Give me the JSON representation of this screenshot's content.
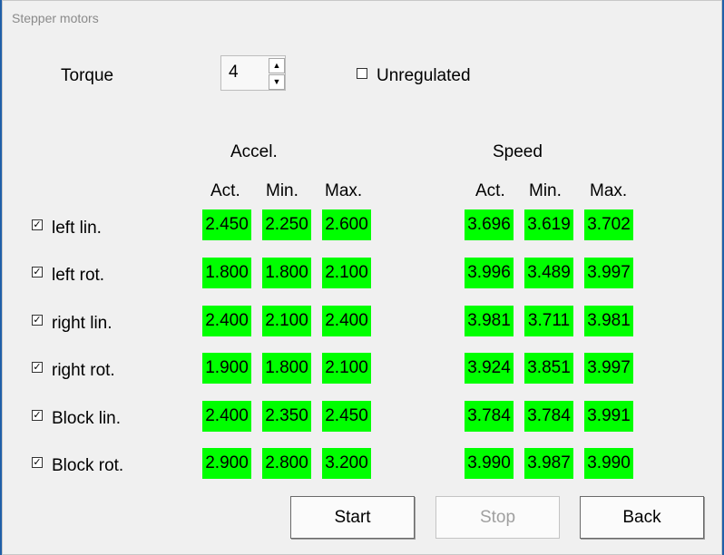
{
  "window": {
    "title": "Stepper motors"
  },
  "torque": {
    "label": "Torque",
    "value": "4",
    "up_arrow": "▲",
    "down_arrow": "▼"
  },
  "unregulated": {
    "label": "Unregulated",
    "checked": false
  },
  "groups": {
    "accel": "Accel.",
    "speed": "Speed"
  },
  "columns": {
    "act": "Act.",
    "min": "Min.",
    "max": "Max."
  },
  "check_mark": "✓",
  "rows": [
    {
      "label": "left lin.",
      "checked": true,
      "accel": [
        "2.450",
        "2.250",
        "2.600"
      ],
      "speed": [
        "3.696",
        "3.619",
        "3.702"
      ]
    },
    {
      "label": "left rot.",
      "checked": true,
      "accel": [
        "1.800",
        "1.800",
        "2.100"
      ],
      "speed": [
        "3.996",
        "3.489",
        "3.997"
      ]
    },
    {
      "label": "right lin.",
      "checked": true,
      "accel": [
        "2.400",
        "2.100",
        "2.400"
      ],
      "speed": [
        "3.981",
        "3.711",
        "3.981"
      ]
    },
    {
      "label": "right rot.",
      "checked": true,
      "accel": [
        "1.900",
        "1.800",
        "2.100"
      ],
      "speed": [
        "3.924",
        "3.851",
        "3.997"
      ]
    },
    {
      "label": "Block lin.",
      "checked": true,
      "accel": [
        "2.400",
        "2.350",
        "2.450"
      ],
      "speed": [
        "3.784",
        "3.784",
        "3.991"
      ]
    },
    {
      "label": "Block rot.",
      "checked": true,
      "accel": [
        "2.900",
        "2.800",
        "3.200"
      ],
      "speed": [
        "3.990",
        "3.987",
        "3.990"
      ]
    }
  ],
  "buttons": {
    "start": "Start",
    "stop": "Stop",
    "back": "Back",
    "stop_enabled": false
  },
  "colors": {
    "ok_cell": "#00ff00",
    "disabled_text": "#a0a0a0"
  }
}
